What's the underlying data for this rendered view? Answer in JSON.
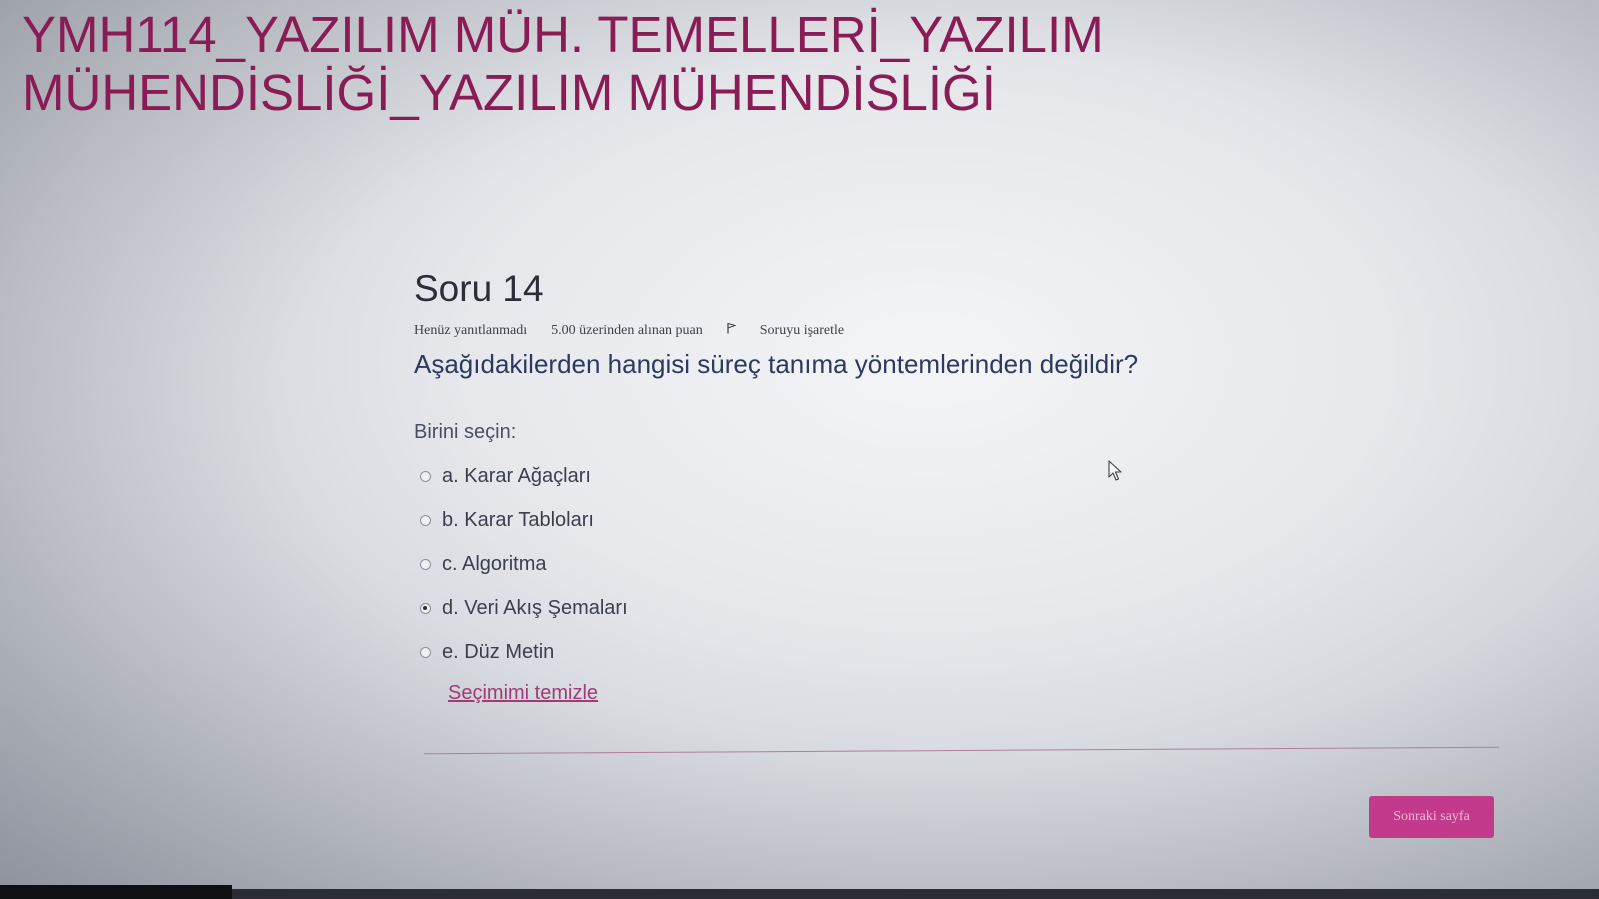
{
  "course": {
    "title": "YMH114_YAZILIM MÜH. TEMELLERİ_YAZILIM MÜHENDİSLİĞİ_YAZILIM MÜHENDİSLİĞİ"
  },
  "question": {
    "heading": "Soru 14",
    "status": "Henüz yanıtlanmadı",
    "points": "5.00 üzerinden alınan puan",
    "flag_label": "Soruyu işaretle",
    "text": "Aşağıdakilerden hangisi süreç tanıma yöntemlerinden değildir?",
    "prompt": "Birini seçin:",
    "answers": [
      {
        "label": "a. Karar Ağaçları",
        "selected": false
      },
      {
        "label": "b. Karar Tabloları",
        "selected": false
      },
      {
        "label": "c. Algoritma",
        "selected": false
      },
      {
        "label": "d. Veri Akış Şemaları",
        "selected": true
      },
      {
        "label": "e. Düz Metin",
        "selected": false
      }
    ],
    "clear_label": "Seçimimi temizle"
  },
  "navigation": {
    "next_label": "Sonraki sayfa"
  },
  "colors": {
    "course_title": "#8a1c55",
    "link": "#a03a78",
    "button": "#c33a8c"
  }
}
